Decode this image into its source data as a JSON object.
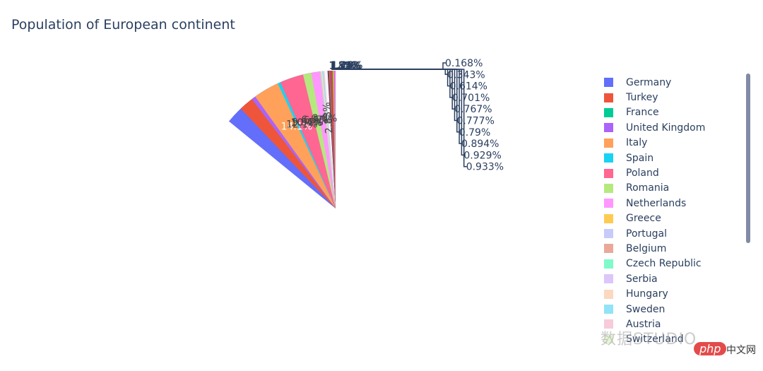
{
  "chart_data": {
    "type": "pie",
    "title": "Population of European continent",
    "direction": "counterclockwise",
    "start": "12 o'clock",
    "slices": [
      {
        "label": "Germany",
        "percent": 14.1,
        "text": "14.1%",
        "color": "#636efa",
        "text_position": "inside"
      },
      {
        "label": "Turkey",
        "percent": 12.1,
        "text": "12.1%",
        "color": "#ef553b",
        "text_position": "inside"
      },
      {
        "label": "France",
        "percent": 10.4,
        "text": "10.4%",
        "color": "#00cc96",
        "text_position": "inside"
      },
      {
        "label": "United Kingdom",
        "percent": 10.4,
        "text": "10.4%",
        "color": "#ab63fa",
        "text_position": "inside"
      },
      {
        "label": "Italy",
        "percent": 9.92,
        "text": "9.92%",
        "color": "#ffa15a",
        "text_position": "inside"
      },
      {
        "label": "Spain",
        "percent": 6.9,
        "text": "6.9%",
        "color": "#19d3f3",
        "text_position": "inside"
      },
      {
        "label": "Poland",
        "percent": 6.57,
        "text": "6.57%",
        "color": "#ff6692",
        "text_position": "inside"
      },
      {
        "label": "Romania",
        "percent": 3.8,
        "text": "3.8%",
        "color": "#b6e880",
        "text_position": "inside"
      },
      {
        "label": "Netherlands",
        "percent": 2.83,
        "text": "2.83%",
        "color": "#ff97ff",
        "text_position": "inside"
      },
      {
        "label": "Greece",
        "percent": 1.83,
        "text": "1.83%",
        "color": "#fecb52",
        "text_position": "outside"
      },
      {
        "label": "Portugal",
        "percent": 1.82,
        "text": "1.82%",
        "color": "#c6cbfa",
        "text_position": "outside"
      },
      {
        "label": "Belgium",
        "percent": 1.77,
        "text": "1.77%",
        "color": "#eba89a",
        "text_position": "outside"
      },
      {
        "label": "Czech Republic",
        "percent": 1.75,
        "text": "1.75%",
        "color": "#7ffacb",
        "text_position": "outside"
      },
      {
        "label": "Serbia",
        "percent": 1.73,
        "text": "1.73%",
        "color": "#dcc6fa",
        "text_position": "outside"
      },
      {
        "label": "Hungary",
        "percent": 1.7,
        "text": "1.7%",
        "color": "#fbd8bf",
        "text_position": "outside"
      },
      {
        "label": "Sweden",
        "percent": 1.54,
        "text": "1.54%",
        "color": "#92e3f5",
        "text_position": "outside"
      },
      {
        "label": "Austria",
        "percent": 1.4,
        "text": "1.4%",
        "color": "#f7cbd9",
        "text_position": "outside"
      },
      {
        "label": "Switzerland",
        "percent": 1.29,
        "text": "1.29%",
        "color": "#e6f5d6",
        "text_position": "outside"
      },
      {
        "label": "",
        "percent": 1.25,
        "text": "1.25%",
        "color": "#fdf5ff",
        "text_position": "outside"
      },
      {
        "label": "",
        "percent": 0.933,
        "text": "0.933%",
        "color": "#fde6bc",
        "text_position": "outside"
      },
      {
        "label": "",
        "percent": 0.929,
        "text": "0.929%",
        "color": "#0d2ee8",
        "text_position": "outside"
      },
      {
        "label": "",
        "percent": 0.894,
        "text": "0.894%",
        "color": "#a63a1e",
        "text_position": "outside"
      },
      {
        "label": "",
        "percent": 0.79,
        "text": "0.79%",
        "color": "#2a5e45",
        "text_position": "outside"
      },
      {
        "label": "",
        "percent": 0.777,
        "text": "0.777%",
        "color": "#7525e0",
        "text_position": "outside"
      },
      {
        "label": "",
        "percent": 0.767,
        "text": "0.767%",
        "color": "#e5772b",
        "text_position": "outside"
      },
      {
        "label": "",
        "percent": 0.701,
        "text": "0.701%",
        "color": "#398799",
        "text_position": "outside"
      },
      {
        "label": "",
        "percent": 0.614,
        "text": "0.614%",
        "color": "#e83552",
        "text_position": "outside"
      },
      {
        "label": "",
        "percent": 0.343,
        "text": "0.343%",
        "color": "#9acd4a",
        "text_position": "outside"
      },
      {
        "label": "",
        "percent": 0.168,
        "text": "0.168%",
        "color": "#e96ae7",
        "text_position": "outside"
      }
    ],
    "legend": {
      "placement": "right",
      "scrollable": true,
      "visible_items": [
        "Germany",
        "Turkey",
        "France",
        "United Kingdom",
        "Italy",
        "Spain",
        "Poland",
        "Romania",
        "Netherlands",
        "Greece",
        "Portugal",
        "Belgium",
        "Czech Republic",
        "Serbia",
        "Hungary",
        "Sweden",
        "Austria",
        "Switzerland"
      ]
    }
  },
  "watermark": {
    "text": "数据STUDIO",
    "php": "php",
    "cn": "中文网"
  }
}
